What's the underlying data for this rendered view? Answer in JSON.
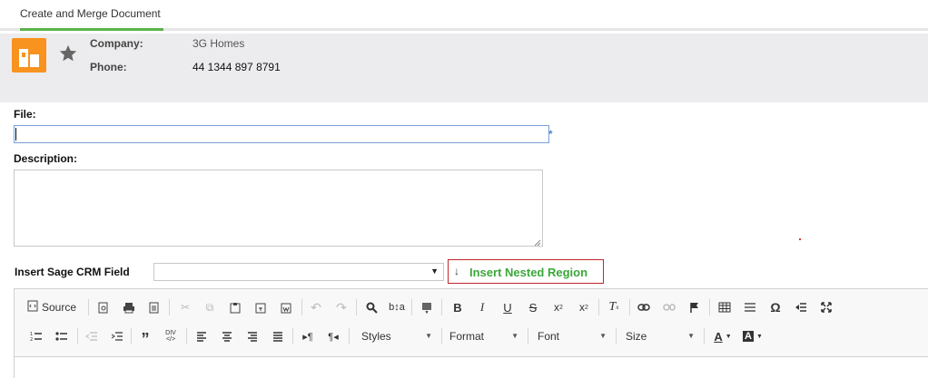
{
  "tab": {
    "label": "Create and Merge Document"
  },
  "header": {
    "company_label": "Company:",
    "company_value": "3G Homes",
    "phone_label": "Phone:",
    "phone_value": "44 1344 897 8791"
  },
  "form": {
    "file_label": "File:",
    "file_value": "",
    "required_mark": "*",
    "description_label": "Description:",
    "description_value": "",
    "insert_field_label": "Insert Sage CRM Field",
    "insert_field_selected": "",
    "nested_region_label": "Insert Nested Region"
  },
  "editor": {
    "source_label": "Source",
    "styles_label": "Styles",
    "format_label": "Format",
    "font_label": "Font",
    "size_label": "Size"
  },
  "colors": {
    "accent_green": "#5ab44a",
    "entity_orange": "#f7931e",
    "nested_border": "#c0272d"
  }
}
